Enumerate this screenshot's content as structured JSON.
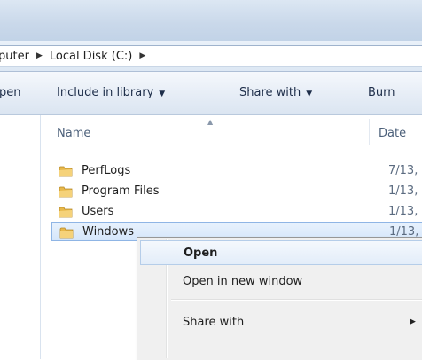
{
  "address": {
    "crumbs": [
      "puter",
      "Local Disk (C:)"
    ]
  },
  "toolbar": {
    "open_label": "pen",
    "include_label": "Include in library",
    "share_label": "Share with",
    "burn_label": "Burn"
  },
  "columns": {
    "name": "Name",
    "date": "Date"
  },
  "files": [
    {
      "name": "PerfLogs",
      "date": "7/13,",
      "icon": "folder-icon"
    },
    {
      "name": "Program Files",
      "date": "1/13,",
      "icon": "folder-icon"
    },
    {
      "name": "Users",
      "date": "1/13,",
      "icon": "folder-icon"
    },
    {
      "name": "Windows",
      "date": "1/13,",
      "icon": "folder-icon",
      "selected": true
    }
  ],
  "context_menu": {
    "items": [
      {
        "label": "Open",
        "default": true
      },
      {
        "label": "Open in new window"
      },
      {
        "label": "Share with",
        "submenu": true
      }
    ]
  },
  "colors": {
    "selection_fill": "#d5e6fb",
    "selection_border": "#8fb5e5",
    "folder": "#e8b84a"
  }
}
